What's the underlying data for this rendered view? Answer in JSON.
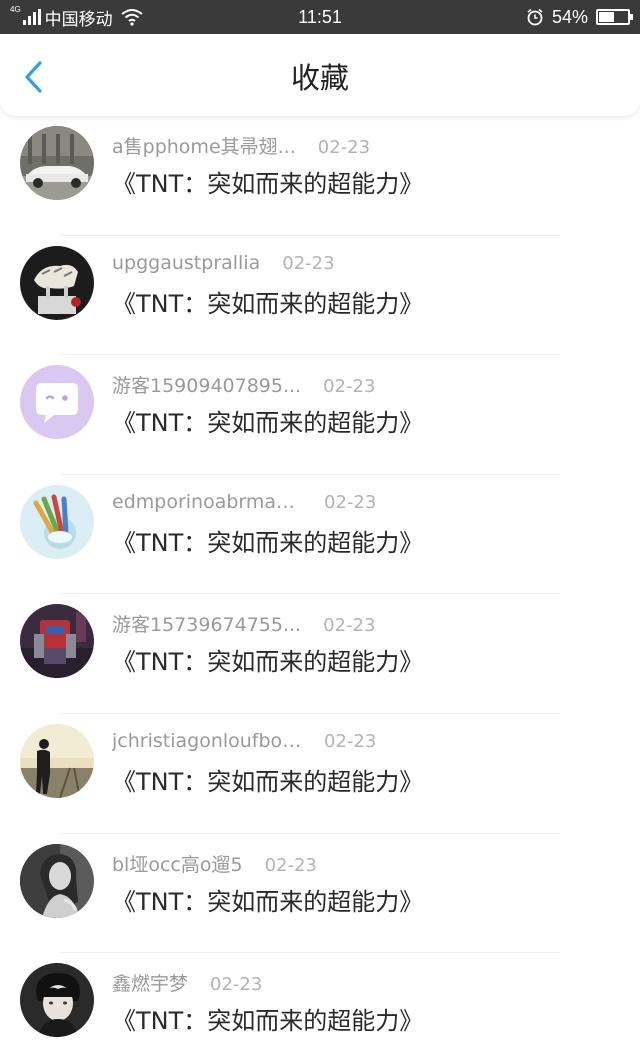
{
  "status_bar": {
    "network": "4G",
    "carrier": "中国移动",
    "time": "11:51",
    "battery_percent_text": "54%",
    "battery_level": 0.54
  },
  "header": {
    "title": "收藏"
  },
  "items": [
    {
      "username": "a售pphome其帚翅...",
      "date": "02-23",
      "title": "《TNT：突如而来的超能力》"
    },
    {
      "username": "upggaustprallia",
      "date": "02-23",
      "title": "《TNT：突如而来的超能力》"
    },
    {
      "username": "游客15909407895...",
      "date": "02-23",
      "title": "《TNT：突如而来的超能力》"
    },
    {
      "username": "edmporinoabrmanib",
      "date": "02-23",
      "title": "《TNT：突如而来的超能力》"
    },
    {
      "username": "游客15739674755...",
      "date": "02-23",
      "title": "《TNT：突如而来的超能力》"
    },
    {
      "username": "jchristiagonloufbout...",
      "date": "02-23",
      "title": "《TNT：突如而来的超能力》"
    },
    {
      "username": "bl垭occ高o遛5",
      "date": "02-23",
      "title": "《TNT：突如而来的超能力》"
    },
    {
      "username": "鑫燃宇梦",
      "date": "02-23",
      "title": "《TNT：突如而来的超能力》"
    }
  ],
  "colors": {
    "accent": "#2f9fe6",
    "status_bar_bg": "#3a3a3a"
  }
}
